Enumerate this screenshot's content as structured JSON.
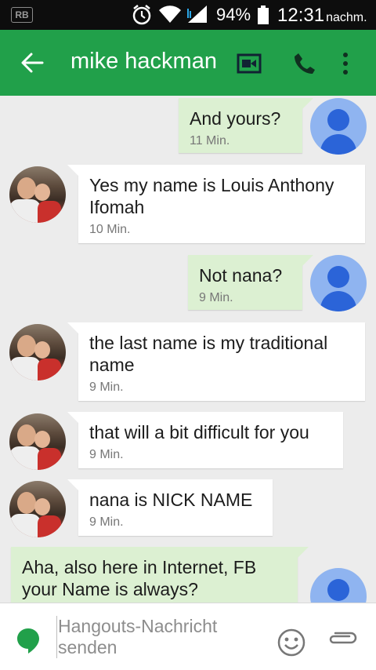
{
  "status_bar": {
    "carrier_badge": "RB",
    "battery_level": "94%",
    "time": "12:31",
    "time_suffix": "nachm.",
    "icons": [
      "alarm-icon",
      "wifi-icon",
      "signal-icon",
      "battery-icon"
    ]
  },
  "header": {
    "back_icon": "back-arrow-icon",
    "contact_name": "mike hackman",
    "actions": [
      "video-call-icon",
      "phone-icon",
      "more-vertical-icon"
    ]
  },
  "messages": [
    {
      "direction": "outgoing",
      "text": "And yours?",
      "time": "11 Min."
    },
    {
      "direction": "incoming",
      "text": "Yes my name is Louis Anthony Ifomah",
      "time": "10 Min."
    },
    {
      "direction": "outgoing",
      "text": "Not nana?",
      "time": "9 Min."
    },
    {
      "direction": "incoming",
      "text": "the last name is my traditional name",
      "time": "9 Min."
    },
    {
      "direction": "incoming",
      "text": "that will a bit difficult for you",
      "time": "9 Min."
    },
    {
      "direction": "incoming",
      "text": "nana is  NICK NAME",
      "time": "9 Min."
    },
    {
      "direction": "outgoing",
      "text": "Aha, also here in Internet, FB your Name is always?",
      "time": ""
    }
  ],
  "composer": {
    "placeholder": "Hangouts-Nachricht senden",
    "icons": [
      "hangouts-icon",
      "emoji-icon",
      "attach-icon"
    ]
  },
  "colors": {
    "app_bar": "#21a04a",
    "outgoing_bubble": "#dcf0d2",
    "incoming_bubble": "#ffffff",
    "own_avatar": "#8fb4f0"
  }
}
